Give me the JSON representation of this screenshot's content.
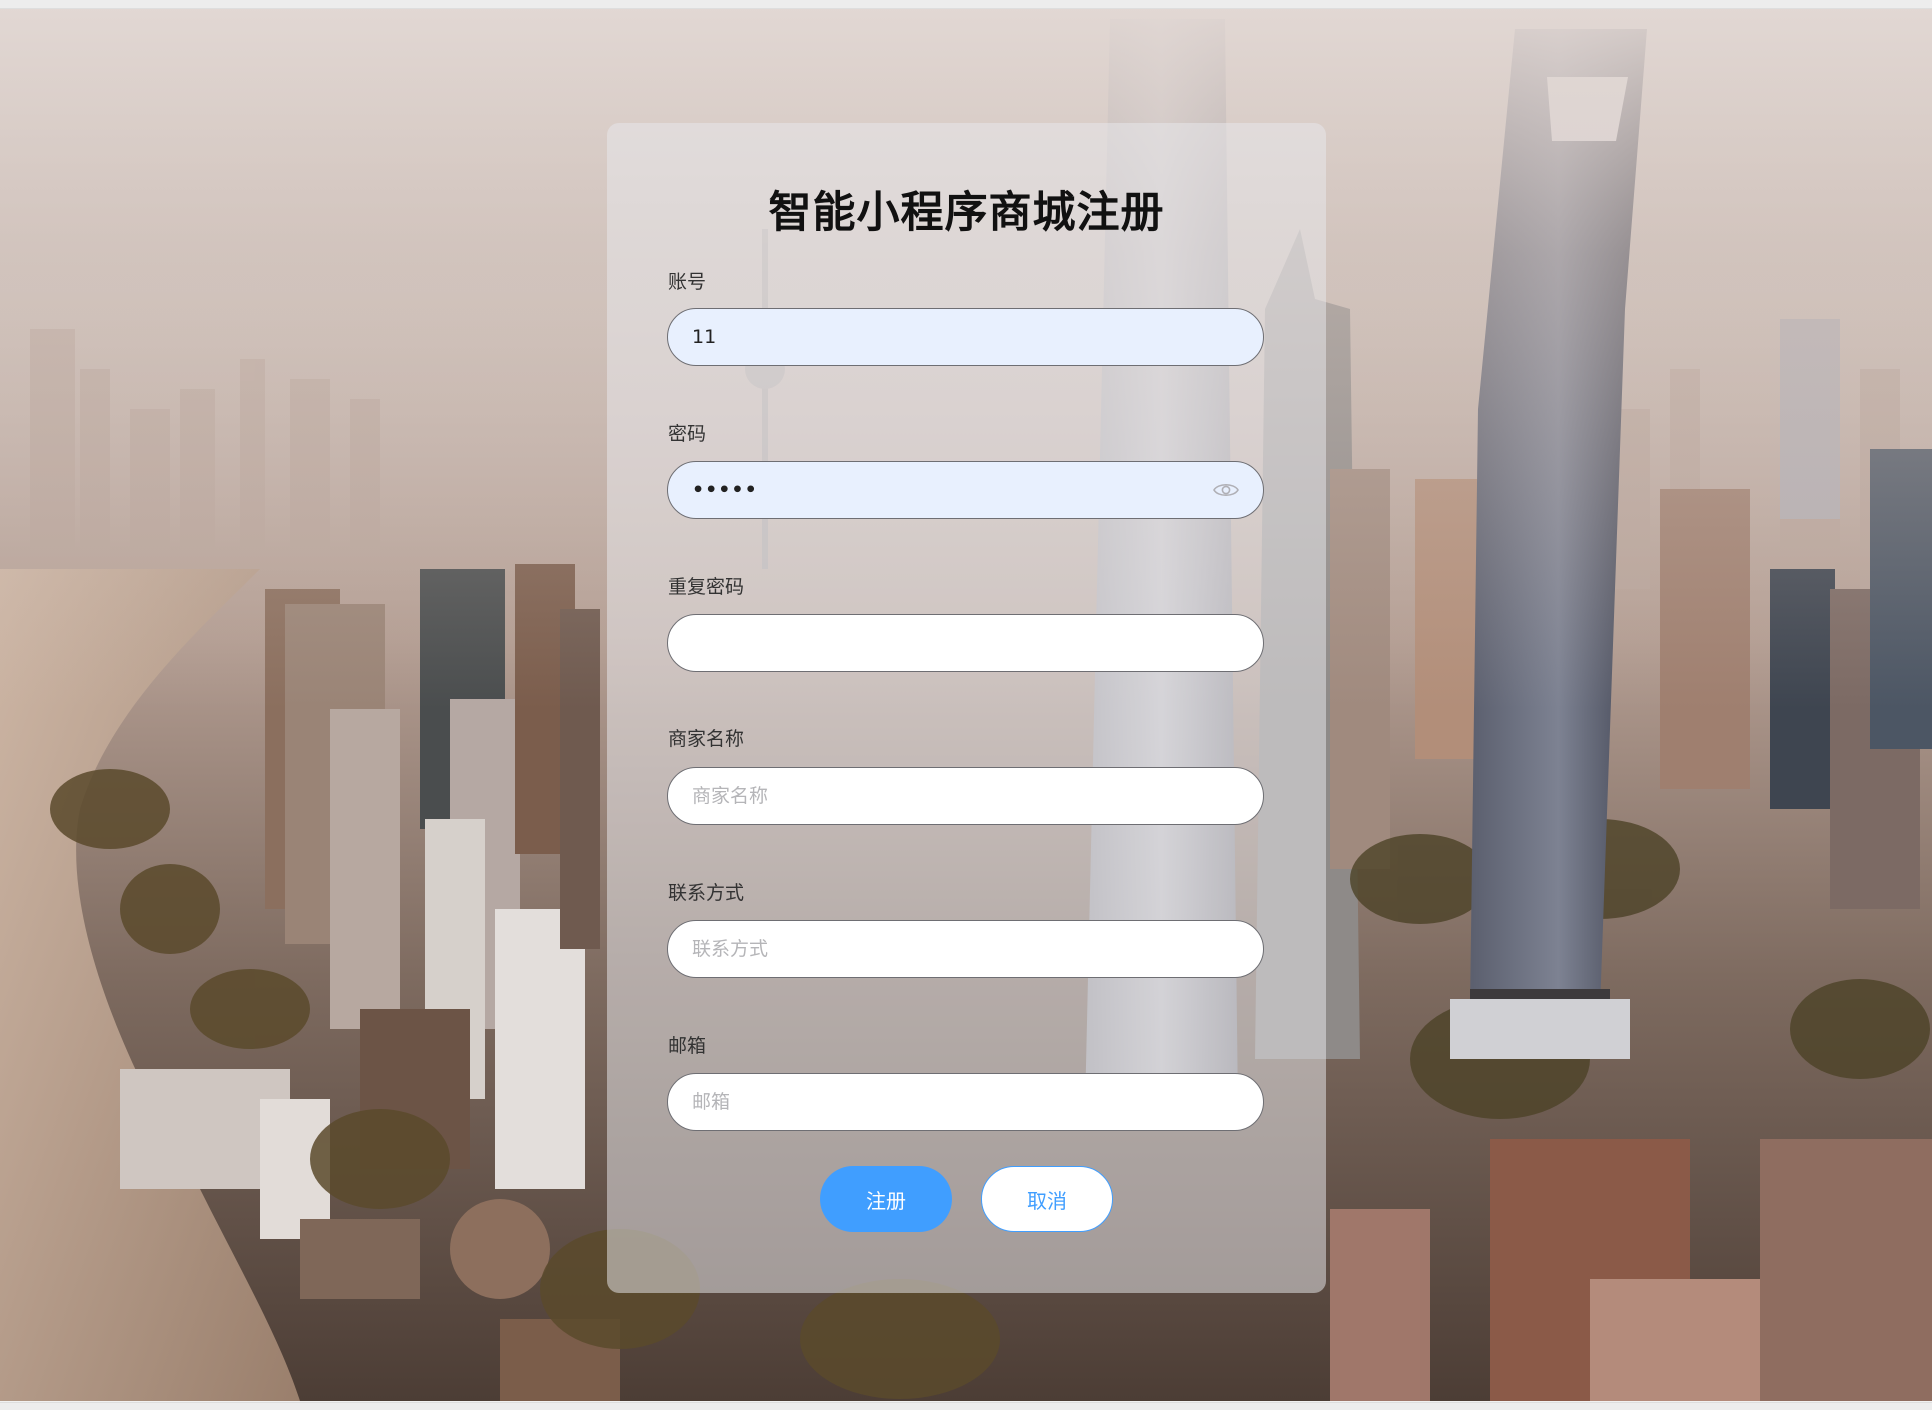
{
  "form": {
    "title": "智能小程序商城注册",
    "fields": [
      {
        "label": "账号",
        "value": "11",
        "placeholder": ""
      },
      {
        "label": "密码",
        "value": "•••••",
        "placeholder": ""
      },
      {
        "label": "重复密码",
        "value": "",
        "placeholder": ""
      },
      {
        "label": "商家名称",
        "value": "",
        "placeholder": "商家名称"
      },
      {
        "label": "联系方式",
        "value": "",
        "placeholder": "联系方式"
      },
      {
        "label": "邮箱",
        "value": "",
        "placeholder": "邮箱"
      }
    ],
    "register_label": "注册",
    "cancel_label": "取消"
  },
  "colors": {
    "primary": "#409eff",
    "filled_input_bg": "#e8f0fe",
    "title": "#111111"
  },
  "icons": {
    "password_toggle": "eye-icon"
  }
}
